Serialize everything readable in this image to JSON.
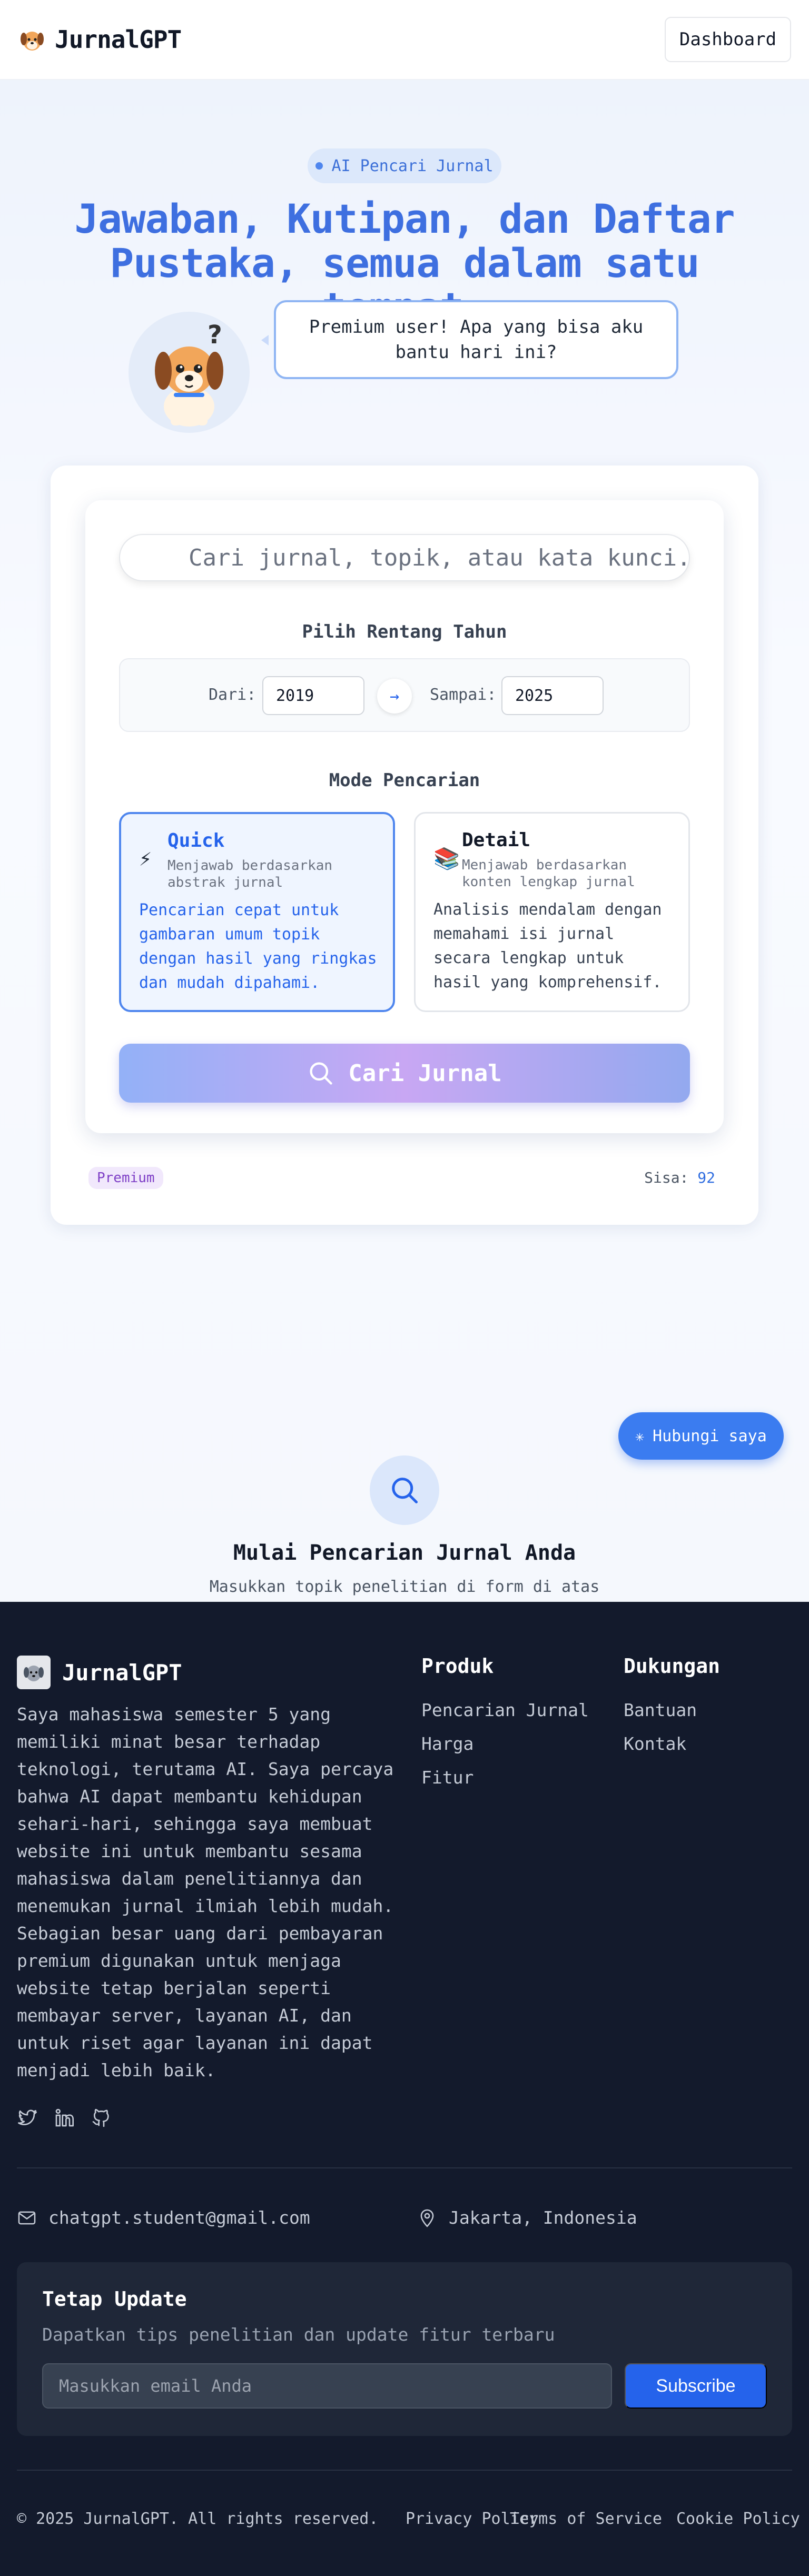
{
  "header": {
    "brand": "JurnalGPT",
    "dashboard_label": "Dashboard"
  },
  "hero": {
    "pill": "AI Pencari Jurnal",
    "title_line1": "Jawaban, Kutipan, dan Daftar",
    "title_line2": "Pustaka, semua dalam satu tempat.",
    "bubble": "Premium user! Apa yang bisa aku bantu hari ini?"
  },
  "search": {
    "placeholder": "Cari jurnal, topik, atau kata kunci...",
    "year_heading": "Pilih Rentang Tahun",
    "from_label": "Dari:",
    "from_value": "2019",
    "arrow": "→",
    "to_label": "Sampai:",
    "to_value": "2025",
    "mode_heading": "Mode Pencarian",
    "modes": [
      {
        "title": "Quick",
        "subtitle": "Menjawab berdasarkan abstrak jurnal",
        "description": "Pencarian cepat untuk gambaran umum topik dengan hasil yang ringkas dan mudah dipahami.",
        "icon": "lightning-icon",
        "selected": true
      },
      {
        "title": "Detail",
        "subtitle": "Menjawab berdasarkan konten lengkap jurnal",
        "description": "Analisis mendalam dengan memahami isi jurnal secara lengkap untuk hasil yang komprehensif.",
        "icon": "books-icon",
        "selected": false
      }
    ],
    "submit_label": "Cari Jurnal",
    "plan_badge": "Premium",
    "remaining_label": "Sisa:",
    "remaining_value": "92"
  },
  "contact_button": "Hubungi saya",
  "empty_state": {
    "title": "Mulai Pencarian Jurnal Anda",
    "subtitle": "Masukkan topik penelitian di form di atas"
  },
  "footer": {
    "brand": "JurnalGPT",
    "about": "Saya mahasiswa semester 5 yang memiliki minat besar terhadap teknologi, terutama AI. Saya percaya bahwa AI dapat membantu kehidupan sehari-hari, sehingga saya membuat website ini untuk membantu sesama mahasiswa dalam penelitiannya dan menemukan jurnal ilmiah lebih mudah. Sebagian besar uang dari pembayaran premium digunakan untuk menjaga website tetap berjalan seperti membayar server, layanan AI, dan untuk riset agar layanan ini dapat menjadi lebih baik.",
    "produk": {
      "title": "Produk",
      "links": [
        "Pencarian Jurnal",
        "Harga",
        "Fitur"
      ]
    },
    "dukungan": {
      "title": "Dukungan",
      "links": [
        "Bantuan",
        "Kontak"
      ]
    },
    "email": "chatgpt.student@gmail.com",
    "location": "Jakarta, Indonesia",
    "newsletter": {
      "title": "Tetap Update",
      "subtitle": "Dapatkan tips penelitian dan update fitur terbaru",
      "placeholder": "Masukkan email Anda",
      "button": "Subscribe"
    },
    "copyright": "© 2025 JurnalGPT. All rights reserved.",
    "legal": [
      "Privacy Policy",
      "Terms of Service",
      "Cookie Policy"
    ]
  },
  "colors": {
    "primary": "#2563eb",
    "title_blue": "#3e6fe0",
    "footer_bg": "#131a2c"
  }
}
